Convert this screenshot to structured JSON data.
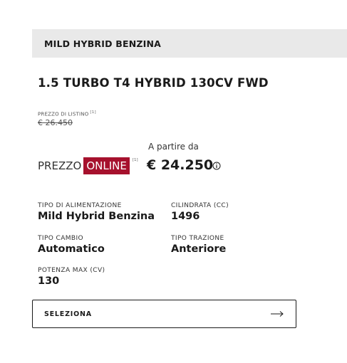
{
  "header": {
    "title": "MILD HYBRID BENZINA"
  },
  "model": {
    "name": "1.5 TURBO T4 HYBRID 130CV FWD"
  },
  "pricing": {
    "list_label": "PREZZO DI LISTINO",
    "list_note": "[1]",
    "list_price": "€ 26.450",
    "starting_from": "A partire da",
    "online_word": "PREZZO",
    "online_badge": "ONLINE",
    "online_note": "[1]",
    "online_price": "€ 24.250",
    "badge_color": "#a6112d"
  },
  "specs": [
    {
      "label": "TIPO DI ALIMENTAZIONE",
      "value": "Mild Hybrid Benzina"
    },
    {
      "label": "CILINDRATA (CC)",
      "value": "1496"
    },
    {
      "label": "TIPO CAMBIO",
      "value": "Automatico"
    },
    {
      "label": "TIPO TRAZIONE",
      "value": "Anteriore"
    },
    {
      "label": "POTENZA MAX (CV)",
      "value": "130"
    }
  ],
  "cta": {
    "label": "SELEZIONA",
    "icon": "arrow-right-icon"
  }
}
